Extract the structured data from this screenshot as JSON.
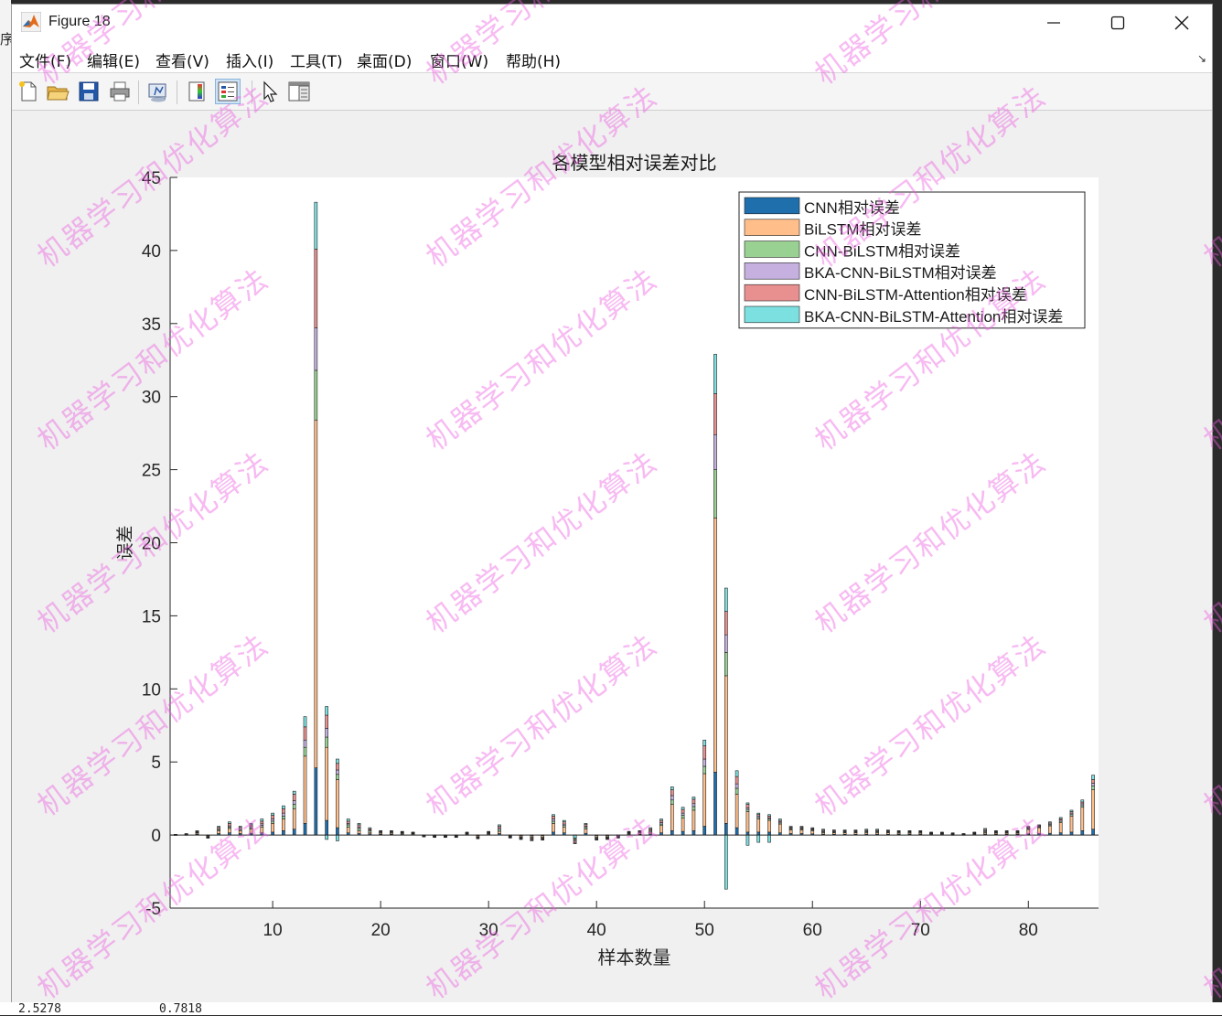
{
  "window": {
    "title": "Figure 18",
    "app_icon": "matlab-logo-icon",
    "controls": [
      "minimize-icon",
      "maximize-icon",
      "close-icon"
    ]
  },
  "menu": [
    "文件(F)",
    "编辑(E)",
    "查看(V)",
    "插入(I)",
    "工具(T)",
    "桌面(D)",
    "窗口(W)",
    "帮助(H)"
  ],
  "toolbar": [
    "new-figure-icon",
    "open-file-icon",
    "save-icon",
    "print-icon",
    "link-plot-icon",
    "insert-colorbar-icon",
    "insert-legend-icon",
    "edit-plot-icon",
    "property-editor-icon"
  ],
  "background_text": {
    "left_fragment": "序",
    "bottom_values": [
      "2.5278",
      "0.7818"
    ]
  },
  "watermark": "机器学习和优化算法",
  "chart_data": {
    "type": "bar",
    "stacked": true,
    "title": "各模型相对误差对比",
    "xlabel": "样本数量",
    "ylabel": "误差",
    "xlim": [
      1,
      86
    ],
    "ylim": [
      -5,
      45
    ],
    "xticks": [
      10,
      20,
      30,
      40,
      50,
      60,
      70,
      80
    ],
    "yticks": [
      -5,
      0,
      5,
      10,
      15,
      20,
      25,
      30,
      35,
      40,
      45
    ],
    "grid": false,
    "legend_position": "top-right",
    "colors": [
      "#1f6fad",
      "#ffbe8a",
      "#98d192",
      "#c5b0df",
      "#e8908f",
      "#7de0e0"
    ],
    "x": [
      1,
      2,
      3,
      4,
      5,
      6,
      7,
      8,
      9,
      10,
      11,
      12,
      13,
      14,
      15,
      16,
      17,
      18,
      19,
      20,
      21,
      22,
      23,
      24,
      25,
      26,
      27,
      28,
      29,
      30,
      31,
      32,
      33,
      34,
      35,
      36,
      37,
      38,
      39,
      40,
      41,
      42,
      43,
      44,
      45,
      46,
      47,
      48,
      49,
      50,
      51,
      52,
      53,
      54,
      55,
      56,
      57,
      58,
      59,
      60,
      61,
      62,
      63,
      64,
      65,
      66,
      67,
      68,
      69,
      70,
      71,
      72,
      73,
      74,
      75,
      76,
      77,
      78,
      79,
      80,
      81,
      82,
      83,
      84,
      85,
      86
    ],
    "totals": [
      0.05,
      0.1,
      0.3,
      -0.2,
      0.6,
      0.9,
      0.6,
      0.8,
      1.1,
      1.5,
      2.0,
      3.0,
      8.1,
      43.3,
      8.8,
      5.2,
      1.1,
      0.8,
      0.5,
      0.3,
      0.3,
      0.25,
      0.2,
      -0.1,
      -0.15,
      -0.15,
      -0.15,
      0.2,
      -0.25,
      0.25,
      0.7,
      -0.2,
      -0.3,
      -0.4,
      -0.35,
      1.4,
      1.0,
      -0.6,
      0.8,
      -0.35,
      -0.3,
      -0.2,
      0.25,
      0.3,
      0.5,
      1.1,
      3.3,
      1.9,
      2.6,
      6.5,
      32.9,
      16.9,
      4.4,
      2.2,
      1.5,
      1.4,
      1.1,
      0.6,
      0.6,
      0.5,
      0.4,
      0.35,
      0.35,
      0.35,
      0.4,
      0.4,
      0.35,
      0.3,
      0.3,
      0.3,
      0.2,
      0.2,
      0.15,
      0.1,
      0.2,
      0.45,
      0.3,
      0.3,
      0.3,
      0.6,
      0.7,
      0.9,
      1.2,
      1.7,
      2.4,
      4.1
    ],
    "series": [
      {
        "name": "CNN相对误差",
        "values": [
          0.01,
          0.02,
          0.05,
          -0.05,
          0.1,
          0.15,
          0.1,
          0.12,
          0.15,
          0.2,
          0.3,
          0.4,
          0.8,
          4.6,
          1.0,
          0.5,
          0.15,
          0.1,
          0.08,
          0.05,
          0.05,
          0.04,
          0.03,
          -0.02,
          -0.03,
          -0.03,
          -0.03,
          0.03,
          -0.04,
          0.04,
          0.1,
          -0.03,
          -0.05,
          -0.06,
          -0.05,
          0.2,
          0.15,
          -0.1,
          0.12,
          -0.05,
          -0.05,
          -0.03,
          0.04,
          0.05,
          0.08,
          0.15,
          0.3,
          0.25,
          0.3,
          0.6,
          4.3,
          0.8,
          0.5,
          0.2,
          0.2,
          0.2,
          0.15,
          0.1,
          0.1,
          0.08,
          0.06,
          0.05,
          0.05,
          0.05,
          0.06,
          0.06,
          0.05,
          0.05,
          0.05,
          0.05,
          0.03,
          0.03,
          0.02,
          0.02,
          0.03,
          0.07,
          0.05,
          0.05,
          0.05,
          0.08,
          0.1,
          0.12,
          0.15,
          0.2,
          0.3,
          0.4
        ]
      },
      {
        "name": "BiLSTM相对误差",
        "values": [
          0.02,
          0.03,
          0.08,
          -0.05,
          0.2,
          0.3,
          0.2,
          0.3,
          0.4,
          0.6,
          0.8,
          1.4,
          4.6,
          23.8,
          5.0,
          3.3,
          0.4,
          0.2,
          0.1,
          0.08,
          0.08,
          0.06,
          0.05,
          -0.03,
          -0.04,
          -0.04,
          -0.04,
          0.05,
          -0.07,
          0.06,
          0.15,
          -0.05,
          -0.08,
          -0.1,
          -0.1,
          0.6,
          0.4,
          -0.15,
          0.3,
          -0.1,
          -0.08,
          -0.05,
          0.06,
          0.08,
          0.1,
          0.5,
          1.8,
          0.9,
          1.4,
          3.6,
          17.4,
          10.1,
          2.3,
          1.4,
          0.9,
          0.8,
          0.6,
          0.25,
          0.25,
          0.2,
          0.1,
          0.1,
          0.1,
          0.1,
          0.1,
          0.1,
          0.1,
          0.08,
          0.08,
          0.08,
          0.05,
          0.05,
          0.04,
          0.03,
          0.05,
          0.1,
          0.08,
          0.08,
          0.08,
          0.3,
          0.4,
          0.5,
          0.7,
          1.1,
          1.6,
          2.7
        ]
      },
      {
        "name": "CNN-BiLSTM相对误差",
        "values": [
          0.005,
          0.01,
          0.04,
          -0.03,
          0.07,
          0.1,
          0.07,
          0.08,
          0.12,
          0.15,
          0.2,
          0.3,
          0.6,
          3.4,
          0.7,
          0.35,
          0.15,
          0.15,
          0.1,
          0.05,
          0.05,
          0.05,
          0.04,
          -0.02,
          -0.02,
          -0.02,
          -0.02,
          0.03,
          -0.04,
          0.04,
          0.12,
          -0.03,
          -0.05,
          -0.06,
          -0.05,
          0.15,
          0.1,
          -0.1,
          0.1,
          -0.05,
          -0.05,
          -0.03,
          0.04,
          0.04,
          0.08,
          0.1,
          0.3,
          0.2,
          0.25,
          0.5,
          3.3,
          1.6,
          0.4,
          0.15,
          0.1,
          0.1,
          0.08,
          0.07,
          0.07,
          0.06,
          0.06,
          0.05,
          0.05,
          0.05,
          0.06,
          0.06,
          0.05,
          0.05,
          0.05,
          0.05,
          0.03,
          0.03,
          0.02,
          0.02,
          0.03,
          0.07,
          0.04,
          0.04,
          0.04,
          0.06,
          0.05,
          0.07,
          0.08,
          0.1,
          0.12,
          0.25
        ]
      },
      {
        "name": "BKA-CNN-BiLSTM相对误差",
        "values": [
          0.005,
          0.01,
          0.03,
          -0.02,
          0.06,
          0.08,
          0.06,
          0.08,
          0.1,
          0.15,
          0.2,
          0.25,
          0.5,
          2.9,
          0.6,
          0.3,
          0.1,
          0.1,
          0.07,
          0.04,
          0.04,
          0.03,
          0.03,
          -0.01,
          -0.02,
          -0.02,
          -0.02,
          0.03,
          -0.03,
          0.03,
          0.1,
          -0.03,
          -0.04,
          -0.06,
          -0.05,
          0.15,
          0.1,
          -0.08,
          0.08,
          -0.05,
          -0.04,
          -0.03,
          0.04,
          0.04,
          0.07,
          0.1,
          0.3,
          0.15,
          0.2,
          0.5,
          2.4,
          1.2,
          0.3,
          0.1,
          0.1,
          0.08,
          0.07,
          0.06,
          0.06,
          0.05,
          0.05,
          0.05,
          0.05,
          0.05,
          0.05,
          0.05,
          0.05,
          0.04,
          0.04,
          0.04,
          0.03,
          0.03,
          0.02,
          0.01,
          0.03,
          0.06,
          0.04,
          0.04,
          0.04,
          0.05,
          0.05,
          0.06,
          0.08,
          0.1,
          0.12,
          0.2
        ]
      },
      {
        "name": "CNN-BiLSTM-Attention相对误差",
        "values": [
          0.005,
          0.01,
          0.05,
          -0.03,
          0.1,
          0.17,
          0.1,
          0.12,
          0.18,
          0.25,
          0.3,
          0.45,
          0.9,
          5.4,
          0.9,
          0.45,
          0.15,
          0.15,
          0.08,
          0.05,
          0.05,
          0.04,
          0.03,
          -0.01,
          -0.02,
          -0.02,
          -0.02,
          0.03,
          -0.04,
          0.04,
          0.13,
          -0.03,
          -0.05,
          -0.07,
          -0.06,
          0.2,
          0.15,
          -0.12,
          0.12,
          -0.06,
          -0.05,
          -0.03,
          0.04,
          0.05,
          0.1,
          0.15,
          0.4,
          0.25,
          0.3,
          0.9,
          2.8,
          1.6,
          0.5,
          0.25,
          0.1,
          0.12,
          0.1,
          0.07,
          0.07,
          0.06,
          0.07,
          0.06,
          0.05,
          0.05,
          0.06,
          0.06,
          0.05,
          0.04,
          0.04,
          0.04,
          0.03,
          0.03,
          0.03,
          0.01,
          0.03,
          0.08,
          0.05,
          0.05,
          0.05,
          0.06,
          0.05,
          0.08,
          0.09,
          0.1,
          0.12,
          0.25
        ]
      },
      {
        "name": "BKA-CNN-BiLSTM-Attention相对误差",
        "values": [
          0.005,
          0.02,
          0.05,
          -0.02,
          0.07,
          0.1,
          0.07,
          0.1,
          0.15,
          0.15,
          0.2,
          0.2,
          0.7,
          3.2,
          0.6,
          0.3,
          0.15,
          0.1,
          0.07,
          0.03,
          0.03,
          0.03,
          0.02,
          -0.01,
          -0.02,
          -0.02,
          -0.02,
          0.03,
          -0.03,
          0.04,
          0.1,
          -0.03,
          -0.03,
          -0.05,
          -0.04,
          0.1,
          0.1,
          -0.05,
          0.08,
          -0.04,
          -0.03,
          -0.03,
          0.03,
          0.04,
          0.07,
          0.1,
          0.2,
          0.15,
          0.15,
          0.4,
          2.7,
          1.6,
          0.4,
          0.1,
          0.09,
          0.1,
          0.1,
          0.05,
          0.05,
          0.05,
          0.06,
          0.04,
          0.05,
          0.05,
          0.07,
          0.07,
          0.05,
          0.04,
          0.04,
          0.04,
          0.03,
          0.03,
          0.02,
          0.01,
          0.03,
          0.07,
          0.04,
          0.04,
          0.04,
          0.05,
          0.05,
          0.07,
          0.08,
          0.1,
          0.14,
          0.3
        ]
      }
    ],
    "negative_bars": {
      "note_free": true,
      "x": [
        52,
        54,
        55,
        56,
        15,
        16,
        38
      ],
      "cyan_values": [
        -3.7,
        -0.7,
        -0.5,
        -0.5,
        -0.3,
        -0.4,
        -0.2
      ]
    }
  }
}
